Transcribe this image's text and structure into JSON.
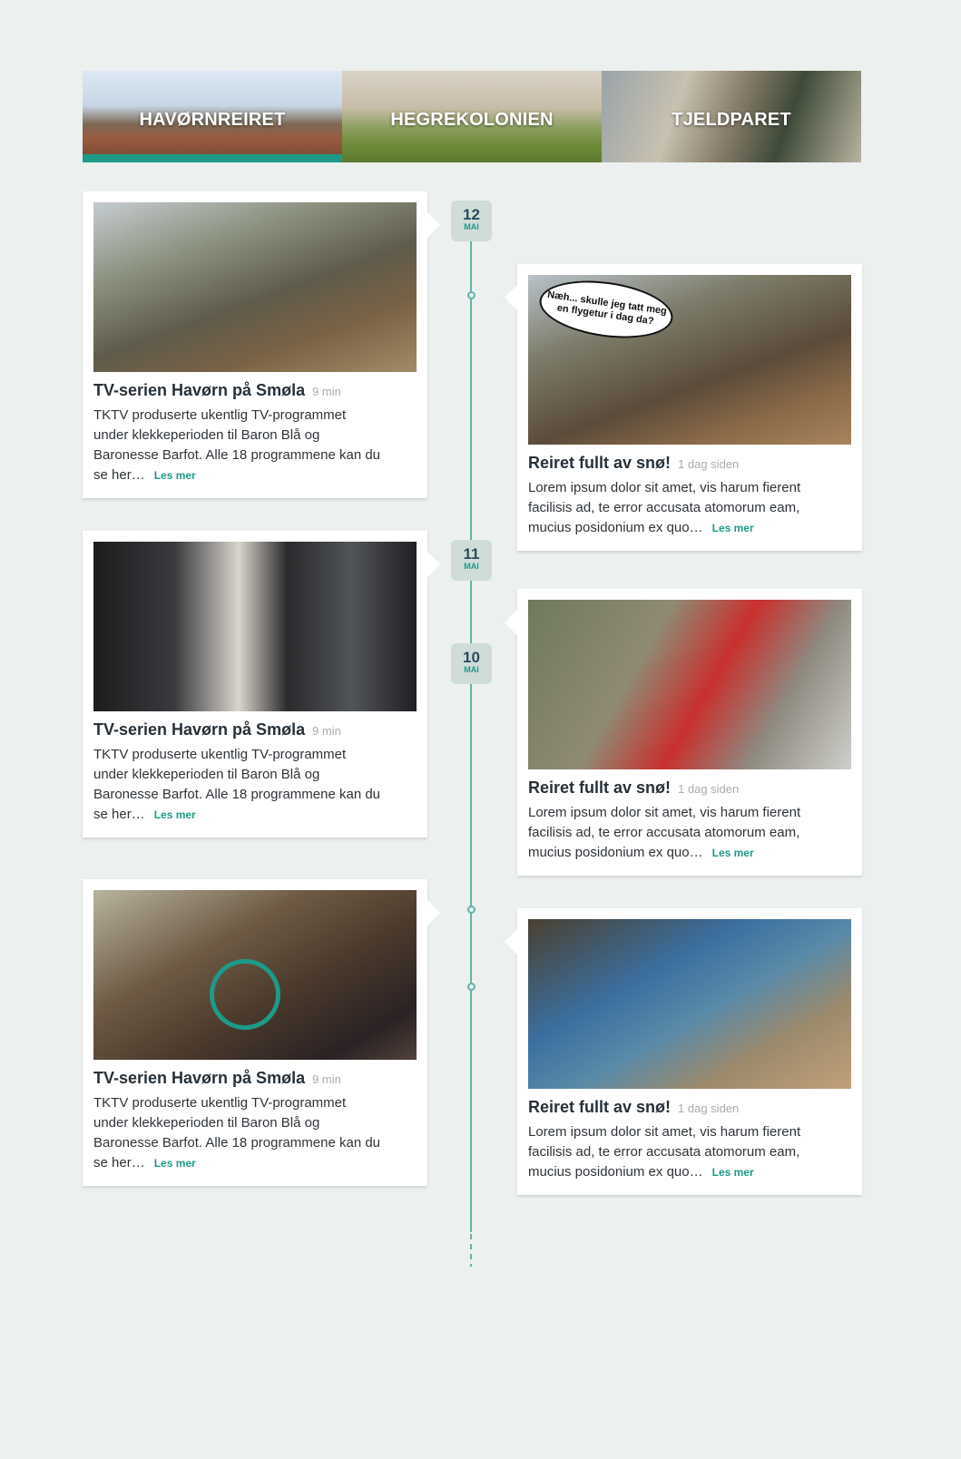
{
  "tabs": [
    {
      "label": "HAVØRNREIRET",
      "active": true
    },
    {
      "label": "HEGREKOLONIEN",
      "active": false
    },
    {
      "label": "TJELDPARET",
      "active": false
    }
  ],
  "dates": [
    {
      "day": "12",
      "month": "MAI"
    },
    {
      "day": "11",
      "month": "MAI"
    },
    {
      "day": "10",
      "month": "MAI"
    }
  ],
  "cards": [
    {
      "title": "TV-serien Havørn på Smøla",
      "meta": "9 min",
      "text": "TKTV produserte ukentlig TV-programmet under klekkeperioden til Baron Blå og Baronesse Barfot. Alle 18 programmene kan du se her…",
      "more": "Les mer"
    },
    {
      "title": "Reiret fullt av snø!",
      "meta": "1 dag siden",
      "text": "Lorem ipsum dolor sit amet, vis harum fierent facilisis ad, te error accusata atomorum eam, mucius posidonium ex quo…",
      "more": "Les mer",
      "bubble": "Næh... skulle jeg tatt meg en flygetur i dag da?"
    },
    {
      "title": "TV-serien Havørn på Smøla",
      "meta": "9 min",
      "text": "TKTV produserte ukentlig TV-programmet under klekkeperioden til Baron Blå og Baronesse Barfot. Alle 18 programmene kan du se her…",
      "more": "Les mer"
    },
    {
      "title": "Reiret fullt av snø!",
      "meta": "1 dag siden",
      "text": "Lorem ipsum dolor sit amet, vis harum fierent facilisis ad, te error accusata atomorum eam, mucius posidonium ex quo…",
      "more": "Les mer"
    },
    {
      "title": "TV-serien Havørn på Smøla",
      "meta": "9 min",
      "text": "TKTV produserte ukentlig TV-programmet under klekkeperioden til Baron Blå og Baronesse Barfot. Alle 18 programmene kan du se her…",
      "more": "Les mer"
    },
    {
      "title": "Reiret fullt av snø!",
      "meta": "1 dag siden",
      "text": "Lorem ipsum dolor sit amet, vis harum fierent facilisis ad, te error accusata atomorum eam, mucius posidonium ex quo…",
      "more": "Les mer"
    }
  ],
  "colors": {
    "accent": "#1d9a88",
    "timeline": "#63b3a8",
    "background": "#ecf0ee",
    "date_badge": "#cfdcd8"
  }
}
